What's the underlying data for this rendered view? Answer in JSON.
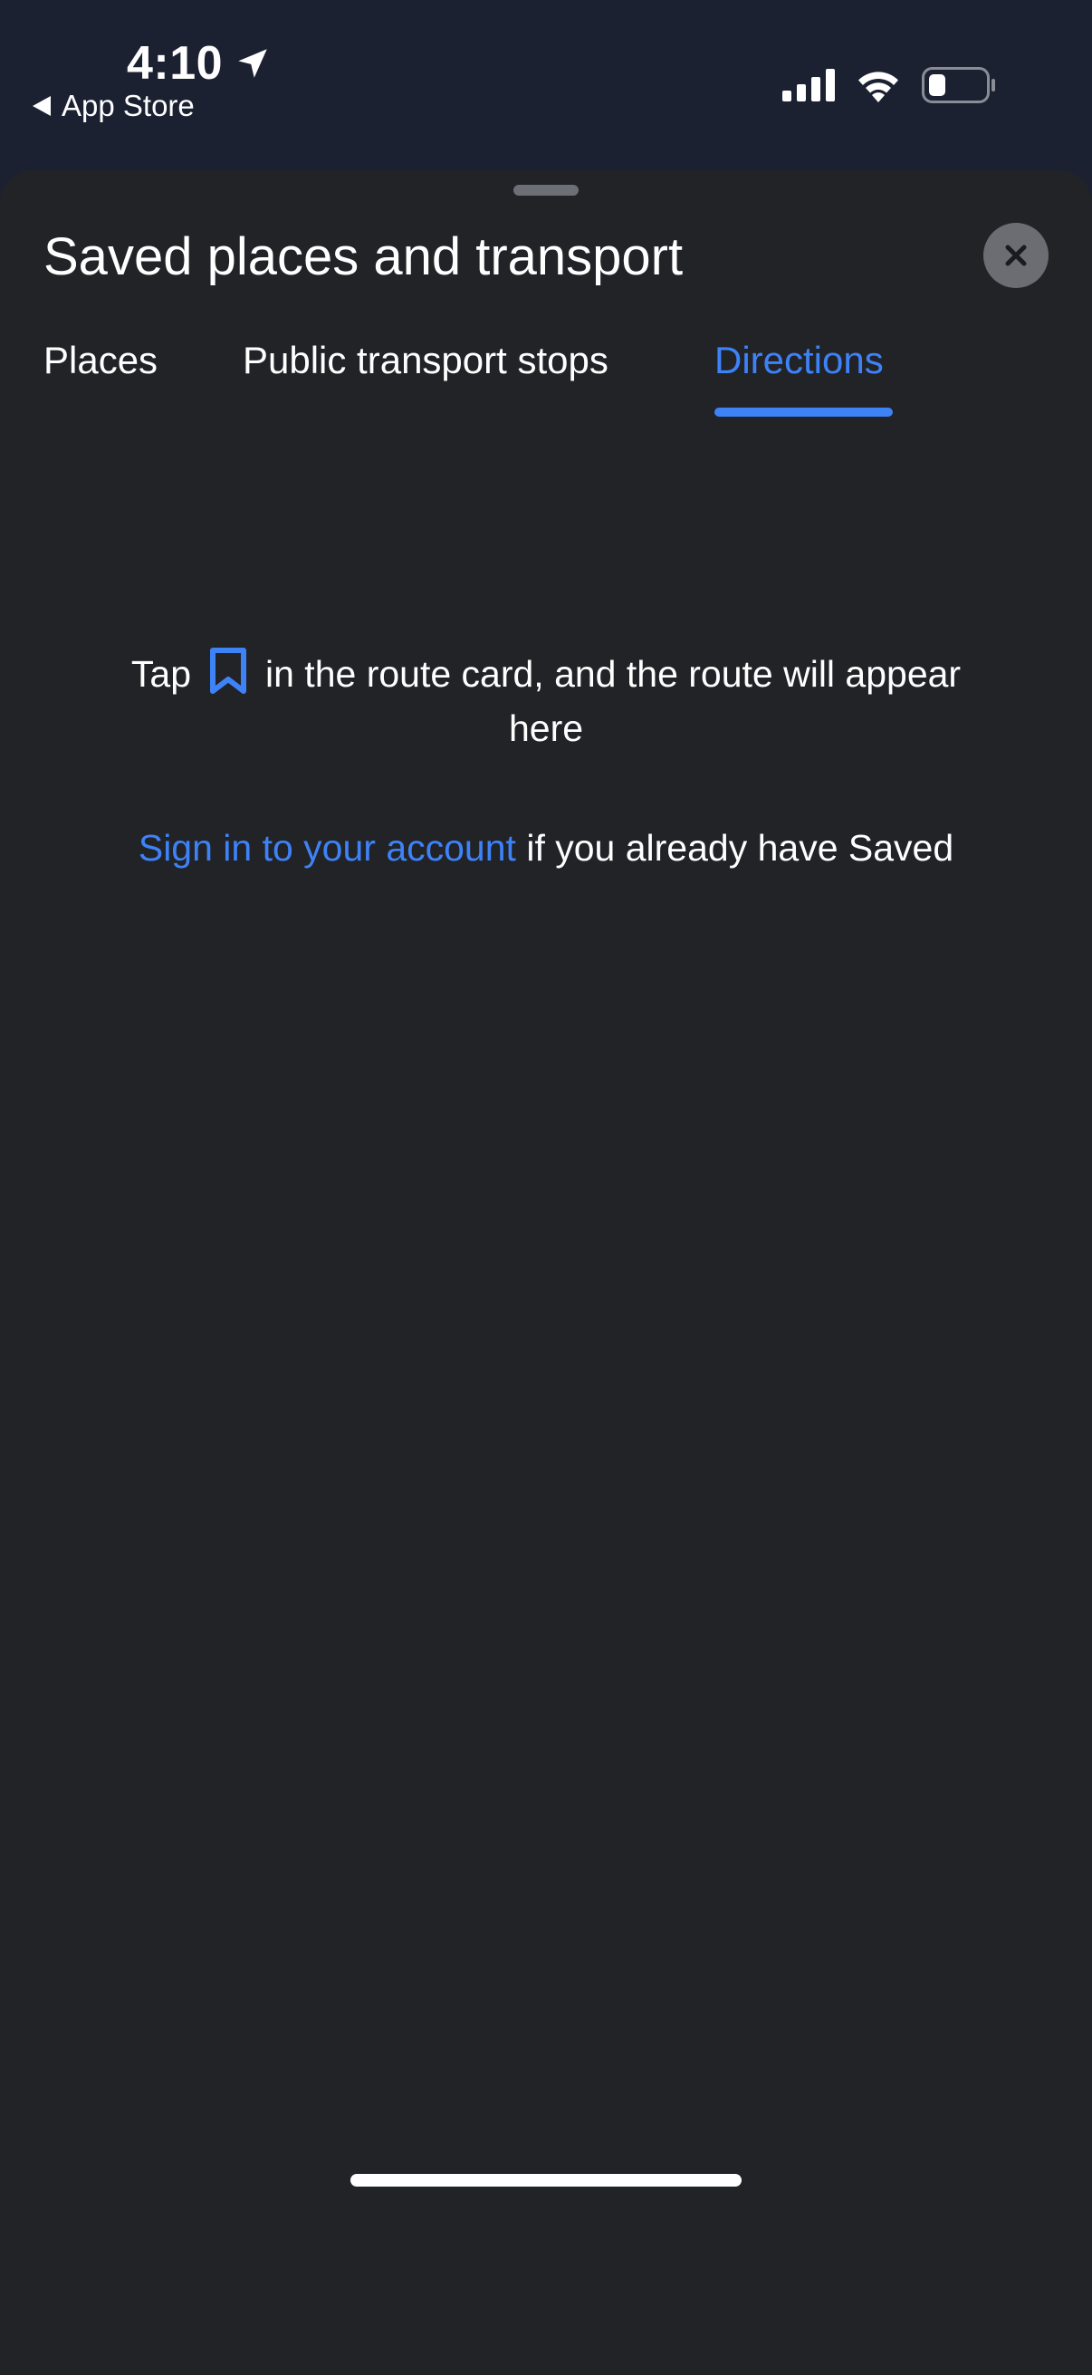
{
  "status_bar": {
    "time": "4:10",
    "back_app_label": "App Store",
    "location_icon": "location-arrow-icon",
    "signal_icon": "cellular-signal-icon",
    "wifi_icon": "wifi-icon",
    "battery_icon": "battery-icon"
  },
  "sheet": {
    "title": "Saved places and transport",
    "close_icon": "close-icon",
    "tabs": [
      {
        "label": "Places",
        "active": false
      },
      {
        "label": "Public transport stops",
        "active": false
      },
      {
        "label": "Directions",
        "active": true
      }
    ],
    "hint": {
      "prefix": "Tap",
      "icon": "bookmark-icon",
      "suffix": "in the route card, and the route will appear here"
    },
    "signin": {
      "link_label": "Sign in to your account",
      "rest": "if you already have Saved"
    }
  },
  "colors": {
    "accent": "#3e82f7",
    "sheet_background": "#222327",
    "status_background": "#1c2132"
  }
}
